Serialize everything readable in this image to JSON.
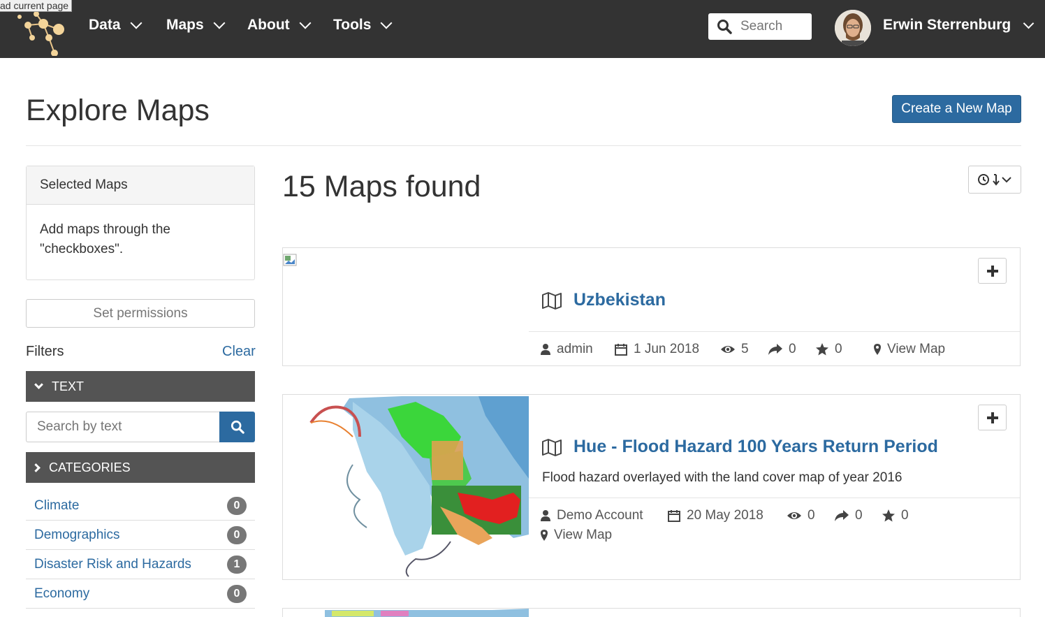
{
  "tooltip": "ad current page",
  "nav": {
    "items": [
      "Data",
      "Maps",
      "About",
      "Tools"
    ],
    "search_placeholder": "Search",
    "user_name": "Erwin Sterrenburg"
  },
  "page": {
    "title": "Explore Maps",
    "create_button": "Create a New Map"
  },
  "sidebar": {
    "selected_maps_title": "Selected Maps",
    "selected_maps_body": "Add maps through the \"checkboxes\".",
    "set_permissions": "Set permissions",
    "filters_label": "Filters",
    "clear_label": "Clear",
    "text_facet": "TEXT",
    "text_search_placeholder": "Search by text",
    "categories_facet": "CATEGORIES",
    "categories": [
      {
        "label": "Climate",
        "count": "0"
      },
      {
        "label": "Demographics",
        "count": "0"
      },
      {
        "label": "Disaster Risk and Hazards",
        "count": "1"
      },
      {
        "label": "Economy",
        "count": "0"
      }
    ]
  },
  "results": {
    "count_text": "15 Maps found",
    "maps": [
      {
        "title": "Uzbekistan",
        "description": "",
        "owner": "admin",
        "date": "1 Jun 2018",
        "views": "5",
        "shares": "0",
        "rating": "0",
        "view_link": "View Map"
      },
      {
        "title": "Hue - Flood Hazard 100 Years Return Period",
        "description": "Flood hazard overlayed with the land cover map of year 2016",
        "owner": "Demo Account",
        "date": "20 May 2018",
        "views": "0",
        "shares": "0",
        "rating": "0",
        "view_link": "View Map"
      }
    ]
  },
  "colors": {
    "navbar": "#333333",
    "accent": "#2c6aa0",
    "facet_bar": "#545454",
    "badge": "#777777"
  }
}
